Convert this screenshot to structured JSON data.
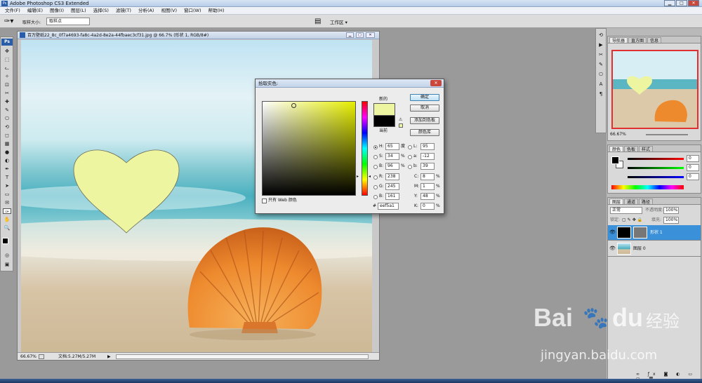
{
  "app": {
    "title": "Adobe Photoshop CS3 Extended"
  },
  "menu": [
    "文件(F)",
    "编辑(E)",
    "图像(I)",
    "图层(L)",
    "选择(S)",
    "滤镜(T)",
    "分析(A)",
    "视图(V)",
    "窗口(W)",
    "帮助(H)"
  ],
  "options": {
    "sample_size_label": "取样大小:",
    "sample_size_value": "取样点",
    "workspace_label": "工作区 ▾"
  },
  "toolbox": {
    "badge": "Ps",
    "tool_icons": [
      "move-icon",
      "marquee-icon",
      "lasso-icon",
      "magic-wand-icon",
      "crop-icon",
      "slice-icon",
      "healing-icon",
      "brush-icon",
      "stamp-icon",
      "history-brush-icon",
      "eraser-icon",
      "gradient-icon",
      "blur-icon",
      "dodge-icon",
      "pen-icon",
      "type-icon",
      "path-select-icon",
      "shape-icon",
      "notes-icon",
      "eyedropper-icon",
      "hand-icon",
      "zoom-icon"
    ],
    "tool_glyphs": [
      "✥",
      "⬚",
      "ᓚ",
      "✧",
      "⊡",
      "✂",
      "✚",
      "✎",
      "⎔",
      "⟲",
      "◻",
      "▦",
      "●",
      "◐",
      "✒",
      "T",
      "➤",
      "▭",
      "✉",
      "✑",
      "✋",
      "🔍"
    ]
  },
  "document": {
    "title": "百万壁纸22_8c_0f7a4693-fa8c-4a2d-8e2a-44fbaec3cf31.jpg @ 66.7% (形状 1, RGB/8#)",
    "zoom": "66.67%",
    "doc_info": "文档:5.27M/5.27M"
  },
  "picker": {
    "title": "拾取实色:",
    "label_new": "新的",
    "label_current": "当前",
    "ok": "确定",
    "cancel": "取消",
    "add_swatch": "添加到色板",
    "libraries": "颜色库",
    "web_only": "只有 Web 颜色",
    "new_color": "#eef5a1",
    "current_color": "#000000",
    "hsb": {
      "h_label": "H:",
      "h": "65",
      "h_unit": "度",
      "s_label": "S:",
      "s": "34",
      "s_unit": "%",
      "b_label": "B:",
      "b": "96",
      "b_unit": "%"
    },
    "rgb": {
      "r_label": "R:",
      "r": "238",
      "g_label": "G:",
      "g": "245",
      "b_label": "B:",
      "b": "161"
    },
    "lab": {
      "l_label": "L:",
      "l": "95",
      "a_label": "a:",
      "a": "-12",
      "b_label": "b:",
      "b": "39"
    },
    "cmyk": {
      "c_label": "C:",
      "c": "8",
      "m_label": "M:",
      "m": "1",
      "y_label": "Y:",
      "y": "48",
      "k_label": "K:",
      "k": "0",
      "unit": "%"
    },
    "hex_label": "#",
    "hex": "eef5a1"
  },
  "navigator": {
    "tabs": [
      "导航器",
      "直方图",
      "信息"
    ],
    "zoom": "66.67%"
  },
  "color_panel": {
    "tabs": [
      "颜色",
      "色板",
      "样式"
    ],
    "r": "0",
    "g": "0",
    "b": "0"
  },
  "layers": {
    "tabs": [
      "图层",
      "通道",
      "路径"
    ],
    "blend_mode": "正常",
    "opacity_label": "不透明度:",
    "opacity": "100%",
    "lock_label": "锁定:",
    "fill_label": "填充:",
    "fill": "100%",
    "items": [
      {
        "name": "形状 1",
        "selected": true
      },
      {
        "name": "图层 0",
        "selected": false
      }
    ]
  },
  "watermark": {
    "brand_left": "Bai",
    "brand_right": "du",
    "cn": "经验",
    "url": "jingyan.baidu.com"
  },
  "colors": {
    "shape_fill": "#eef5a1",
    "layer_selected": "#3a90d9"
  }
}
